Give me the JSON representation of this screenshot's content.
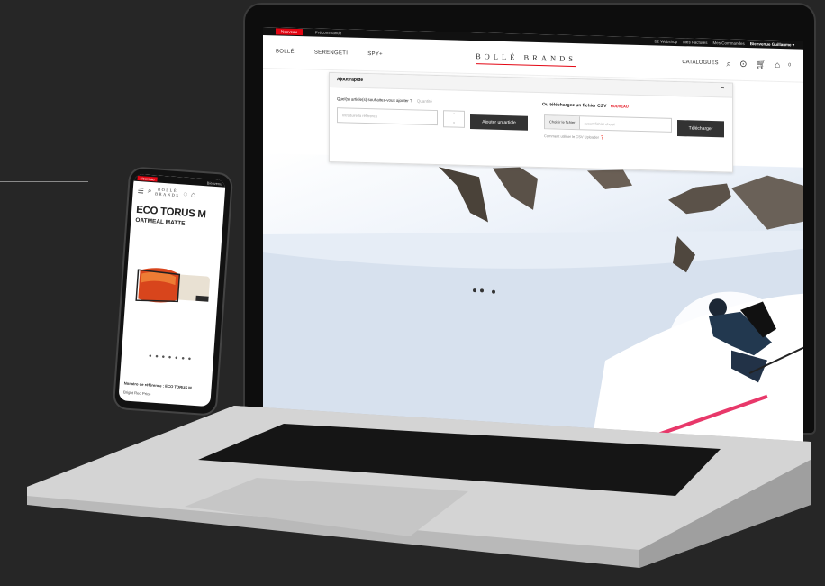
{
  "laptop": {
    "topbar": {
      "tabs": [
        "Nouveau",
        "Précommande"
      ],
      "links": [
        "B2 Webshop",
        "Mes Factures",
        "Mes Commandes",
        "Bienvenue Guillaume ▾"
      ]
    },
    "nav": {
      "brands": [
        "BOLLÉ",
        "SERENGETI",
        "SPY+"
      ],
      "logo": "BOLLÉ BRANDS",
      "catalogues": "CATALOGUES",
      "cart_count": "0"
    },
    "quick_add": {
      "title": "Ajout rapide",
      "question": "Quel(s) article(s) souhaitez-vous ajouter ?",
      "quantity_label": "Quantité",
      "reference_placeholder": "Introduire la référence",
      "add_button": "Ajouter un article",
      "csv_title": "Ou téléchargez un fichier CSV",
      "csv_new": "NOUVEAU",
      "choose_file": "Choisir le fichier",
      "no_file": "aucun fichier choisi",
      "download_button": "Télécharger",
      "help_text": "Comment utiliser le CSV Uploader ❓"
    }
  },
  "phone": {
    "topbar": {
      "tab": "Nouveau",
      "right": "Bienvenu"
    },
    "logo_line1": "BOLLÉ",
    "logo_line2": "BRANDS",
    "product_title": "ECO TORUS M",
    "product_subtitle": "OATMEAL MATTE",
    "ref_label": "Numéro de référence : ECO TORUS M",
    "price_label": "Bright Red Price"
  },
  "colors": {
    "accent": "#e30613",
    "background": "#262626"
  },
  "icons": [
    "menu-icon",
    "search-icon",
    "glasses-icon",
    "cart-icon",
    "chevron-up-icon",
    "help-icon"
  ]
}
